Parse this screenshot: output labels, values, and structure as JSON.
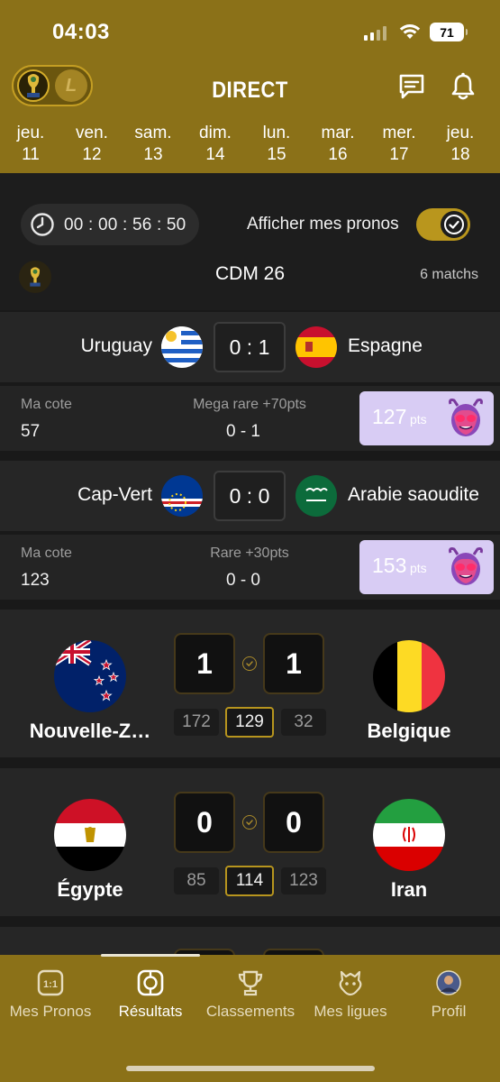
{
  "status_bar": {
    "time": "04:03",
    "battery": "71"
  },
  "header": {
    "title": "DIRECT",
    "logo_b_letter": "L",
    "days": [
      {
        "dow": "jeu.",
        "num": "11"
      },
      {
        "dow": "ven.",
        "num": "12"
      },
      {
        "dow": "sam.",
        "num": "13"
      },
      {
        "dow": "dim.",
        "num": "14"
      },
      {
        "dow": "lun.",
        "num": "15"
      },
      {
        "dow": "mar.",
        "num": "16"
      },
      {
        "dow": "mer.",
        "num": "17"
      },
      {
        "dow": "jeu.",
        "num": "18"
      }
    ]
  },
  "panel": {
    "timer": "00 : 00 : 56 : 50",
    "show_pronos_label": "Afficher mes pronos",
    "show_pronos_on": true,
    "competition": "CDM 26",
    "match_count": "6 matchs"
  },
  "compact_matches": [
    {
      "home": "Uruguay",
      "away": "Espagne",
      "score": "0 : 1",
      "home_flag": "uruguay-flag",
      "away_flag": "spain-flag",
      "cote_label": "Ma cote",
      "cote_value": "57",
      "rarity": "Mega rare +70pts",
      "prono": "0 - 1",
      "pts": "127",
      "pts_unit": "pts"
    },
    {
      "home": "Cap-Vert",
      "away": "Arabie saoudite",
      "score": "0 : 0",
      "home_flag": "cape-verde-flag",
      "away_flag": "saudi-arabia-flag",
      "cote_label": "Ma cote",
      "cote_value": "123",
      "rarity": "Rare +30pts",
      "prono": "0 - 0",
      "pts": "153",
      "pts_unit": "pts"
    }
  ],
  "big_matches": [
    {
      "home": "Nouvelle-Z…",
      "away": "Belgique",
      "home_score": "1",
      "away_score": "1",
      "home_flag": "new-zealand-flag",
      "away_flag": "belgium-flag",
      "odds": [
        "172",
        "129",
        "32"
      ]
    },
    {
      "home": "Égypte",
      "away": "Iran",
      "home_score": "0",
      "away_score": "0",
      "home_flag": "egypt-flag",
      "away_flag": "iran-flag",
      "odds": [
        "85",
        "114",
        "123"
      ]
    }
  ],
  "nav": [
    {
      "label": "Mes Pronos",
      "icon": "score-card-icon"
    },
    {
      "label": "Résultats",
      "icon": "ball-icon",
      "active": true
    },
    {
      "label": "Classements",
      "icon": "trophy-icon"
    },
    {
      "label": "Mes ligues",
      "icon": "league-icon"
    },
    {
      "label": "Profil",
      "icon": "avatar-icon"
    }
  ],
  "colors": {
    "brand_gold": "#8b7118",
    "accent_gold": "#b9961d",
    "points_card": "#d8ccf4",
    "background": "#191919"
  }
}
